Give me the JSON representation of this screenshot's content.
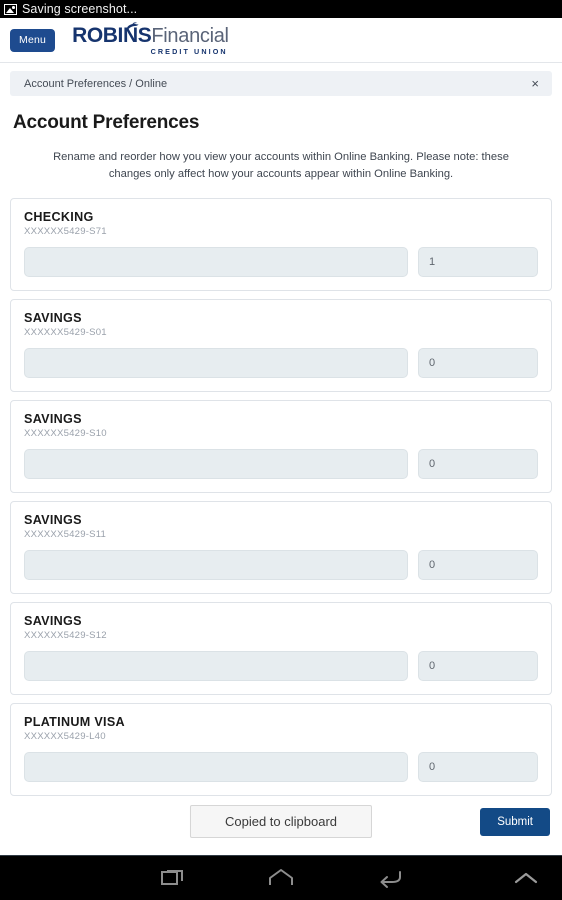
{
  "status_bar": {
    "icon": "screenshot-image-icon",
    "text": "Saving screenshot..."
  },
  "header": {
    "menu_label": "Menu",
    "brand_primary": "ROBINS",
    "brand_secondary": "Financial",
    "brand_tagline": "CREDIT UNION",
    "brand_color": "#16346e",
    "menu_bg": "#1e4b8f"
  },
  "breadcrumb": {
    "text": "Account Preferences / Online",
    "close_icon": "close-icon",
    "close_label": "×"
  },
  "page": {
    "title": "Account Preferences",
    "description": "Rename and reorder how you view your accounts within Online Banking. Please note: these changes only affect how your accounts appear within Online Banking."
  },
  "accounts": [
    {
      "name": "CHECKING",
      "number": "XXXXXX5429-S71",
      "nickname": "",
      "nickname_placeholder": "",
      "order": "1"
    },
    {
      "name": "SAVINGS",
      "number": "XXXXXX5429-S01",
      "nickname": "",
      "nickname_placeholder": "",
      "order": "0"
    },
    {
      "name": "SAVINGS",
      "number": "XXXXXX5429-S10",
      "nickname": "",
      "nickname_placeholder": "",
      "order": "0"
    },
    {
      "name": "SAVINGS",
      "number": "XXXXXX5429-S11",
      "nickname": "",
      "nickname_placeholder": "",
      "order": "0"
    },
    {
      "name": "SAVINGS",
      "number": "XXXXXX5429-S12",
      "nickname": "",
      "nickname_placeholder": "",
      "order": "0"
    },
    {
      "name": "PLATINUM VISA",
      "number": "XXXXXX5429-L40",
      "nickname": "",
      "nickname_placeholder": "",
      "order": "0"
    }
  ],
  "footer": {
    "toast_text": "Copied to clipboard",
    "submit_label": "Submit",
    "submit_color": "#134a86"
  },
  "nav_bar": {
    "recents_icon": "recents-icon",
    "home_icon": "home-icon",
    "back_icon": "back-icon",
    "expand_icon": "chevron-up-icon"
  }
}
